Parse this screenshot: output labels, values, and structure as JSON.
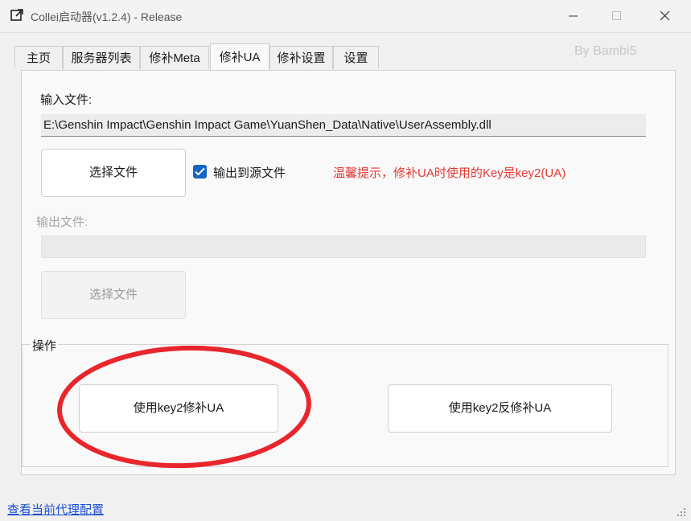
{
  "window": {
    "title": "Collei启动器(v1.2.4) - Release",
    "icon": "external-window-icon"
  },
  "byline": "By Bambi5",
  "tabs": [
    {
      "label": "主页",
      "active": false
    },
    {
      "label": "服务器列表",
      "active": false
    },
    {
      "label": "修补Meta",
      "active": false
    },
    {
      "label": "修补UA",
      "active": true
    },
    {
      "label": "修补设置",
      "active": false
    },
    {
      "label": "设置",
      "active": false
    }
  ],
  "input_section": {
    "label": "输入文件:",
    "path": "E:\\Genshin Impact\\Genshin Impact Game\\YuanShen_Data\\Native\\UserAssembly.dll",
    "select_button": "选择文件",
    "checkbox_label": "输出到源文件",
    "checkbox_checked": true,
    "hint": "温馨提示，修补UA时使用的Key是key2(UA)"
  },
  "output_section": {
    "label": "输出文件:",
    "path": "",
    "select_button": "选择文件"
  },
  "operations": {
    "group_title": "操作",
    "patch_button": "使用key2修补UA",
    "unpatch_button": "使用key2反修补UA"
  },
  "footer": {
    "proxy_link": "查看当前代理配置"
  },
  "colors": {
    "accent": "#1565c0",
    "hint": "#e53935",
    "link": "#1a4fd6",
    "annotation": "#e8262b"
  }
}
